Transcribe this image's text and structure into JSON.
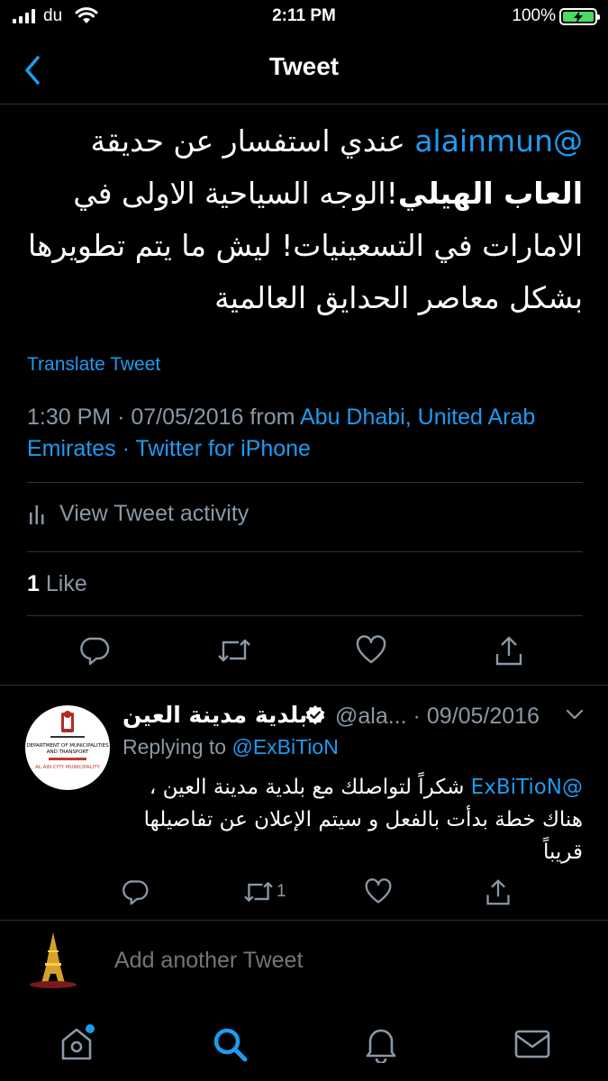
{
  "status_bar": {
    "carrier": "du",
    "time": "2:11 PM",
    "battery_percent": "100%",
    "battery_level": 1.0,
    "charging": true
  },
  "nav": {
    "title": "Tweet"
  },
  "tweet": {
    "mention": "@alainmun",
    "text_part1": " عندي استفسار عن حديقة ",
    "bold": "العاب الهيلي",
    "text_part2": "!الوجه السياحية الاولى في الامارات في التسعينيات! ليش ما يتم تطويرها بشكل معاصر الحدايق العالمية",
    "translate_label": "Translate Tweet",
    "time": "1:30 PM",
    "date": "07/05/2016",
    "from_label": "from",
    "location": "Abu Dhabi, United Arab Emirates",
    "separator": "·",
    "source": "Twitter for iPhone",
    "activity_label": "View Tweet activity",
    "like_count": "1",
    "like_label": "Like"
  },
  "reply": {
    "name": "بلدية مدينة العين",
    "handle": "@ala...",
    "separator": "·",
    "date": "09/05/2016",
    "replying_label": "Replying to",
    "replying_to": "@ExBiTioN",
    "mention": "@ExBiTioN",
    "text": " شكراً لتواصلك مع بلدية مدينة العين ، هناك خطة بدأت بالفعل و سيتم الإعلان عن تفاصيلها قريباً",
    "retweet_count": "1",
    "avatar_text_en1": "DEPARTMENT OF MUNICIPALITIES",
    "avatar_text_en2": "AND TRANSPORT",
    "avatar_text_en3": "AL AIN CITY MUNICIPALITY"
  },
  "compose": {
    "placeholder": "Add another Tweet"
  },
  "colors": {
    "accent": "#1d9bf0",
    "muted": "#8b98a5",
    "divider": "#2f3336",
    "battery": "#4cd964"
  },
  "icons": {
    "back": "chevron-left-icon",
    "reply": "reply-icon",
    "retweet": "retweet-icon",
    "like": "heart-icon",
    "share": "share-icon",
    "home": "home-icon",
    "search": "search-icon",
    "notifications": "bell-icon",
    "messages": "mail-icon"
  }
}
